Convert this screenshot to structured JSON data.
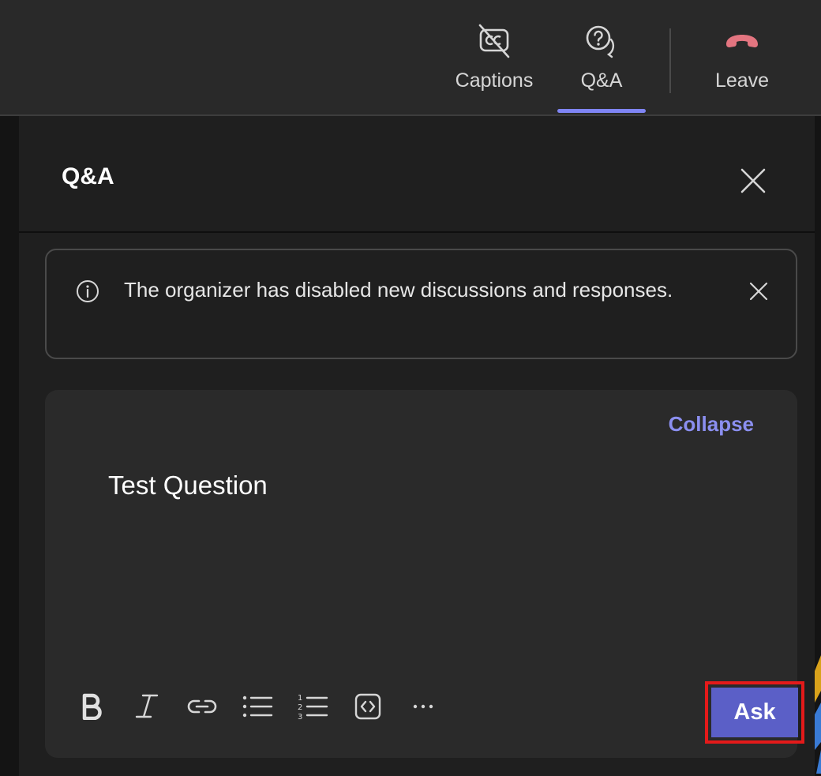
{
  "topbar": {
    "captions_label": "Captions",
    "qa_label": "Q&A",
    "leave_label": "Leave",
    "accent_color": "#7f85f5",
    "leave_color": "#e37580"
  },
  "panel": {
    "title": "Q&A",
    "notice_text": "The organizer has disabled new discussions and responses."
  },
  "composer": {
    "collapse_label": "Collapse",
    "question_value": "Test Question",
    "ask_label": "Ask",
    "ask_color": "#5b5fc7",
    "highlight_color": "#e41a1a",
    "toolbar_items": [
      "bold-icon",
      "italic-icon",
      "link-icon",
      "bulleted-list-icon",
      "numbered-list-icon",
      "code-snippet-icon",
      "more-options-icon"
    ]
  }
}
